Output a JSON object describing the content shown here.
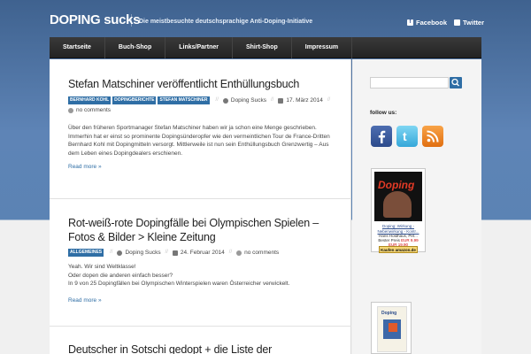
{
  "header": {
    "logo": "DOPING sucks",
    "tagline": "Die meistbesuchte deutschsprachige Anti-Doping-Initiative",
    "social": [
      {
        "label": "Facebook",
        "icon": "facebook-icon"
      },
      {
        "label": "Twitter",
        "icon": "twitter-icon"
      }
    ]
  },
  "nav": {
    "items": [
      "Startseite",
      "Buch-Shop",
      "Links/Partner",
      "Shirt-Shop",
      "Impressum"
    ]
  },
  "posts": [
    {
      "title": "Stefan Matschiner veröffentlicht Enthüllungsbuch",
      "tags": [
        "Bernhard Kohl",
        "Dopingberichte",
        "Stefan Matschiner"
      ],
      "author": "Doping Sucks",
      "date": "17. März 2014",
      "comments": "no comments",
      "excerpt": "Über den früheren Sportmanager Stefan Matschiner haben wir ja schon eine Menge geschrieben. Immerhin hat er einst so prominente Dopingsünderopfer wie den vermeintlichen Tour de France-Dritten Bernhard Kohl mit Dopingmitteln versorgt. Mittlerweile ist nun sein Enthüllungsbuch Grenzwertig – Aus dem Leben eines Dopingdealers erschienen.",
      "readmore": "Read more »"
    },
    {
      "title": "Rot-weiß-rote Dopingfälle bei Olympischen Spielen – Fotos & Bilder > Kleine Zeitung",
      "tags": [
        "Allgemeines"
      ],
      "author": "Doping Sucks",
      "date": "24. Februar 2014",
      "comments": "no comments",
      "excerpt_lines": [
        "Yeah. Wir sind Weltklasse!",
        "Oder dopen die anderen einfach besser?",
        "In 9 von 25 Dopingfällen bei Olympischen Winterspielen waren Österreicher verwickelt."
      ],
      "readmore": "Read more »"
    },
    {
      "title": "Deutscher in Sotschi gedopt + die Liste der"
    }
  ],
  "sidebar": {
    "search": {
      "placeholder": "",
      "button_icon": "search-icon"
    },
    "follow_label": "follow us:",
    "social_icons": [
      "facebook-icon",
      "twitter-icon",
      "rss-icon"
    ],
    "book1": {
      "cover_title": "Doping",
      "caption": "Doping: Wirkung - Nebenwirkung - Kontr...",
      "author": "Hans Holdhaus, Pet...",
      "price_label": "Bester Preis",
      "price_old": "EUR 9,99",
      "price": "EUR 19,90",
      "buy_label": "Kaufen amazon.de"
    },
    "book2": {
      "cover_title": "Doping"
    }
  },
  "colors": {
    "accent": "#2f6ea5",
    "background_top": "#4a6fa0",
    "nav_bg": "#2d2d2d"
  }
}
